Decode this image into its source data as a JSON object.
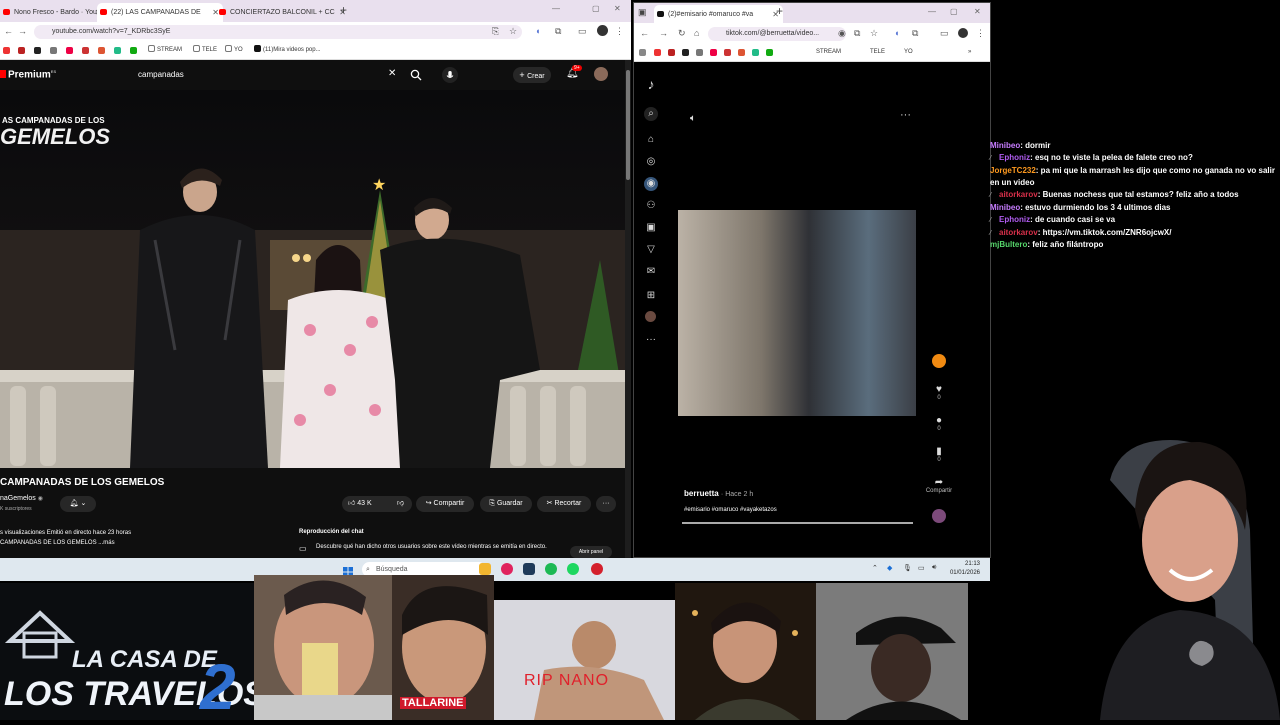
{
  "left_window": {
    "tabs": [
      {
        "label": "Nono Fresco - Bardo · You"
      },
      {
        "label": "(22) LAS CAMPANADAS DE"
      },
      {
        "label": "CONCIERTAZO BALCONIL + CC"
      }
    ],
    "new_tab": "+",
    "url": "youtube.com/watch?v=7_KDRbc3SyE",
    "bookmarks": [
      "STREAM",
      "TELE",
      "YO",
      "(11)Mira videos pop..."
    ],
    "youtube": {
      "logo": "Premium",
      "logo_sup": "ES",
      "search_value": "campanadas",
      "create_label": "Crear",
      "notif_count": "9+",
      "video_overlay_top": "AS CAMPANADAS DE LOS",
      "video_overlay_bottom": "GEMELOS",
      "video_title": "CAMPANADAS DE LOS GEMELOS",
      "channel": "naGemelos",
      "subs": "K suscriptores",
      "likes": "43 K",
      "share_label": "Compartir",
      "save_label": "Guardar",
      "clip_label": "Recortar",
      "more_label": "···",
      "desc_line1": "s visualizaciones  Emitió en directo hace 23 horas",
      "desc_line2": "CAMPANADAS DE LOS GEMELOS ...más",
      "chat_replay_title": "Reproducción del chat",
      "chat_replay_text": "Descubre qué han dicho otros usuarios sobre este vídeo mientras se emitía en directo.",
      "chat_replay_button": "Abrir panel"
    }
  },
  "right_window": {
    "tab_label": "(2)#emisario #omaruco #va",
    "new_tab": "+",
    "url": "tiktok.com/@berruetta/video...",
    "bookmarks": [
      "STREAM",
      "TELE",
      "YO"
    ],
    "tiktok": {
      "username": "berruetta",
      "time": "Hace 2 h",
      "tags": "#emisario #omaruco #vayaketazos",
      "likes": "0",
      "comments": "0",
      "saves": "0",
      "share_label": "Compartir",
      "more": "···"
    }
  },
  "taskbar": {
    "search_placeholder": "Búsqueda",
    "time": "21:13",
    "date": "01/01/2026"
  },
  "stream_chat": [
    {
      "user": "Minibeo",
      "color": "#c77dff",
      "badge": "",
      "text": ": dormir"
    },
    {
      "user": "Ephoniz",
      "color": "#b05cf0",
      "badge": "⁄",
      "text": ": esq no te viste la pelea de falete creo no?"
    },
    {
      "user": "JorgeTC232",
      "color": "#ff9a1f",
      "badge": "",
      "text": ": pa mi que la marrash les dijo que como no ganada no vo salir en un video"
    },
    {
      "user": "aitorkarov",
      "color": "#d8304a",
      "badge": "⁄",
      "text": ": Buenas nochess que tal estamos? feliz año a todos"
    },
    {
      "user": "Minibeo",
      "color": "#c77dff",
      "badge": "",
      "text": ": estuvo durmiendo los 3 4 ultimos dias"
    },
    {
      "user": "Ephoniz",
      "color": "#b05cf0",
      "badge": "⁄",
      "text": ": de cuando casi se va"
    },
    {
      "user": "aitorkarov",
      "color": "#d8304a",
      "badge": "⁄",
      "text": ": https://vm.tiktok.com/ZNR6ojcwX/"
    },
    {
      "user": "mjBultero",
      "color": "#56d66b",
      "badge": "",
      "text": ": feliz año filántropo"
    }
  ],
  "bottom_strip": {
    "show_logo_line1": "LA CASA DE",
    "show_logo_line2": "LOS TRAVELOS",
    "show_logo_number": "2",
    "caption_tallarine": "TALLARINE",
    "caption_ripnano": "RIP NANO"
  },
  "colors": {
    "youtube_red": "#ff0000",
    "tiktok_accent": "#fe2c55",
    "taskbar": "#dfe8ef"
  }
}
